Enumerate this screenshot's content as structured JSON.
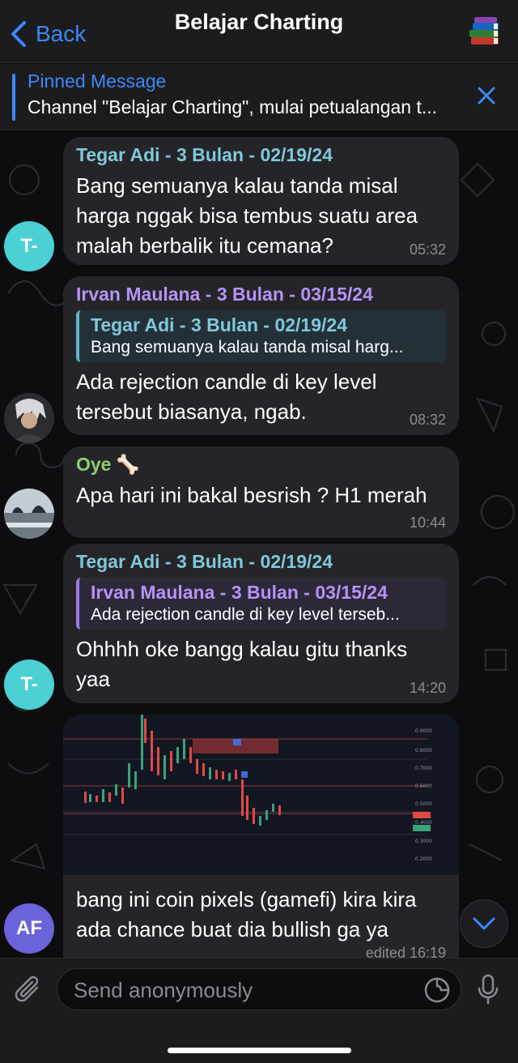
{
  "header": {
    "back_label": "Back",
    "title": "Belajar Charting",
    "avatar_icon": "books-icon"
  },
  "pinned": {
    "title": "Pinned Message",
    "text": "Channel \"Belajar Charting\", mulai petualangan t..."
  },
  "messages": [
    {
      "sender": "Tegar Adi - 3 Bulan - 02/19/24",
      "avatar": "T-",
      "text": "Bang semuanya kalau tanda misal harga nggak bisa tembus suatu area malah berbalik itu cemana?",
      "time": "05:32"
    },
    {
      "sender": "Irvan Maulana - 3 Bulan - 03/15/24",
      "reply_name": "Tegar Adi - 3 Bulan - 02/19/24",
      "reply_text": "Bang semuanya kalau tanda misal harg...",
      "text": "Ada rejection candle di key level tersebut biasanya, ngab.",
      "time": "08:32"
    },
    {
      "sender": "Oye 🦴",
      "text": "Apa hari ini bakal besrish ? H1 merah",
      "time": "10:44"
    },
    {
      "sender": "Tegar Adi - 3 Bulan - 02/19/24",
      "avatar": "T-",
      "reply_name": "Irvan Maulana - 3 Bulan - 03/15/24",
      "reply_text": "Ada rejection candle di key level terseb...",
      "text": "Ohhhh oke bangg kalau gitu thanks yaa",
      "time": "14:20"
    },
    {
      "avatar": "AF",
      "text": "bang ini coin pixels (gamefi) kira kira ada chance buat dia bullish ga ya",
      "time": "edited 16:19"
    }
  ],
  "input": {
    "placeholder": "Send anonymously"
  },
  "colors": {
    "accent": "#3e88f7",
    "bubble": "#252529",
    "teal_name": "#7fc8da",
    "violet_name": "#b693f5",
    "green_name": "#8dcf6e"
  }
}
